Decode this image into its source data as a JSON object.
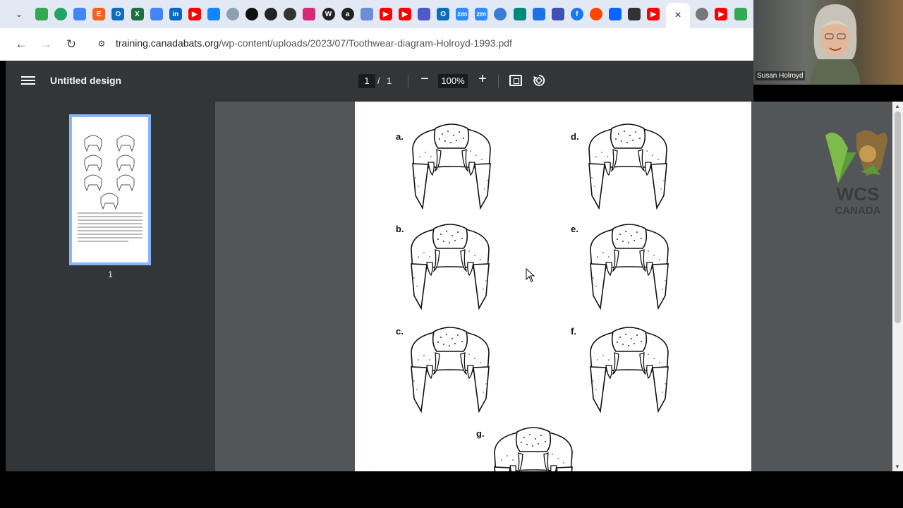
{
  "browser": {
    "active_tab_close": "×",
    "url_host": "training.canadabats.org",
    "url_path": "/wp-content/uploads/2023/07/Toothwear-diagram-Holroyd-1993.pdf",
    "tab_icons": [
      "google-drive-icon",
      "chat-icon",
      "docs-icon",
      "etsy-icon",
      "outlook-icon",
      "excel-icon",
      "docs-icon",
      "linkedin-icon",
      "youtube-icon",
      "bluesky-icon",
      "edge-icon",
      "threads-icon",
      "chatgpt-icon",
      "circle-icon",
      "instagram-icon",
      "wordpress-icon",
      "amazon-icon",
      "paint-icon",
      "youtube-icon",
      "youtube-icon",
      "teams-icon",
      "outlook-icon",
      "zoom-icon",
      "zoom-icon",
      "copilot-icon",
      "meet-icon",
      "video-icon",
      "print-icon",
      "facebook-icon",
      "reddit-icon",
      "meta-icon",
      "medium-icon",
      "youtube-icon",
      "globe-icon",
      "youtube-icon",
      "maps-icon"
    ]
  },
  "pdf": {
    "title": "Untitled design",
    "current_page": "1",
    "page_separator": "/",
    "total_pages": "1",
    "zoom": "100%",
    "zoom_out": "−",
    "zoom_in": "+",
    "thumbnail_label": "1",
    "figure_labels": [
      "a.",
      "b.",
      "c.",
      "d.",
      "e.",
      "f.",
      "g."
    ]
  },
  "webcam": {
    "participant_name": "Susan Holroyd"
  },
  "logo": {
    "name": "WCS",
    "sub": "CANADA"
  },
  "colors": {
    "toolbar": "#323639",
    "viewer_bg": "#525659",
    "thumb_border": "#8ab4f8",
    "logo_green": "#7dbb4a"
  }
}
